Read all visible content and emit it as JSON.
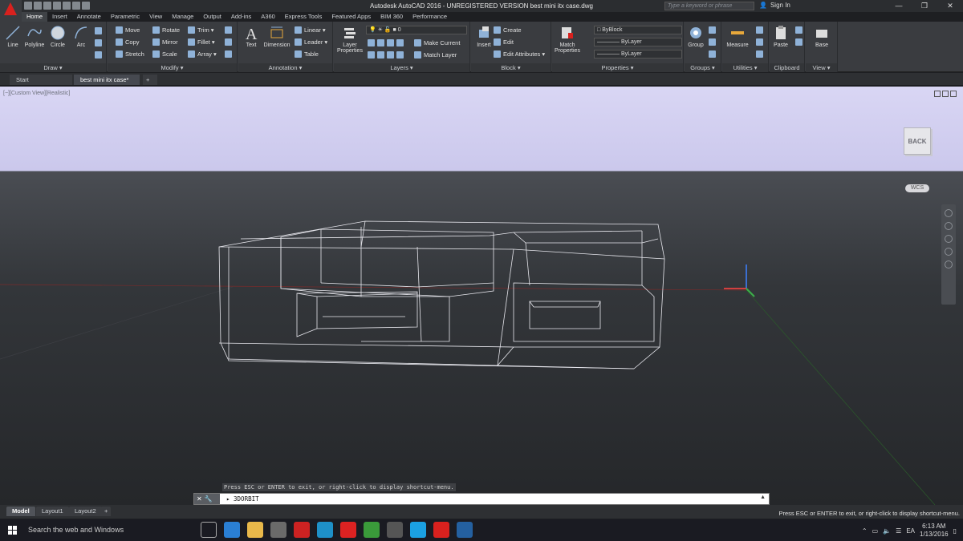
{
  "app": {
    "title": "Autodesk AutoCAD 2016 - UNREGISTERED VERSION    best mini itx case.dwg",
    "search_placeholder": "Type a keyword or phrase",
    "sign_in": "Sign In"
  },
  "ribbon_tabs": [
    "Home",
    "Insert",
    "Annotate",
    "Parametric",
    "View",
    "Manage",
    "Output",
    "Add-ins",
    "A360",
    "Express Tools",
    "Featured Apps",
    "BIM 360",
    "Performance"
  ],
  "draw": {
    "line": "Line",
    "polyline": "Polyline",
    "circle": "Circle",
    "arc": "Arc",
    "label": "Draw ▾"
  },
  "modify": {
    "move": "Move",
    "rotate": "Rotate",
    "trim": "Trim ▾",
    "copy": "Copy",
    "mirror": "Mirror",
    "fillet": "Fillet ▾",
    "stretch": "Stretch",
    "scale": "Scale",
    "array": "Array ▾",
    "label": "Modify ▾"
  },
  "annotation": {
    "text": "Text",
    "dimension": "Dimension",
    "linear": "Linear ▾",
    "leader": "Leader ▾",
    "table": "Table",
    "label": "Annotation ▾"
  },
  "layers": {
    "layer_properties": "Layer Properties",
    "layer_value": "0",
    "make_current": "Make Current",
    "match_layer": "Match Layer",
    "label": "Layers ▾"
  },
  "block": {
    "insert": "Insert",
    "create": "Create",
    "edit": "Edit",
    "edit_attributes": "Edit Attributes ▾",
    "label": "Block ▾"
  },
  "properties": {
    "match": "Match Properties",
    "byblock": "ByBlock",
    "bylayer1": "———— ByLayer",
    "bylayer2": "———— ByLayer",
    "label": "Properties ▾"
  },
  "groups": {
    "group": "Group",
    "label": "Groups ▾"
  },
  "utilities": {
    "measure": "Measure",
    "label": "Utilities ▾"
  },
  "clipboard": {
    "paste": "Paste",
    "label": "Clipboard"
  },
  "view": {
    "base": "Base",
    "label": "View ▾"
  },
  "doc_tabs": {
    "start": "Start",
    "active": "best mini itx case*"
  },
  "viewport": {
    "label": "[−][Custom View][Realistic]",
    "cube": "BACK",
    "wcs": "WCS"
  },
  "command": {
    "hint": "Press ESC or ENTER to exit, or right-click to display shortcut-menu.",
    "text": "3DORBIT"
  },
  "layout_tabs": [
    "Model",
    "Layout1",
    "Layout2"
  ],
  "status_text": "Press ESC or ENTER to exit, or right-click to display shortcut-menu.",
  "taskbar": {
    "search": "Search the web and Windows",
    "lang": "EA",
    "time": "6:13 AM",
    "date": "1/13/2016"
  }
}
